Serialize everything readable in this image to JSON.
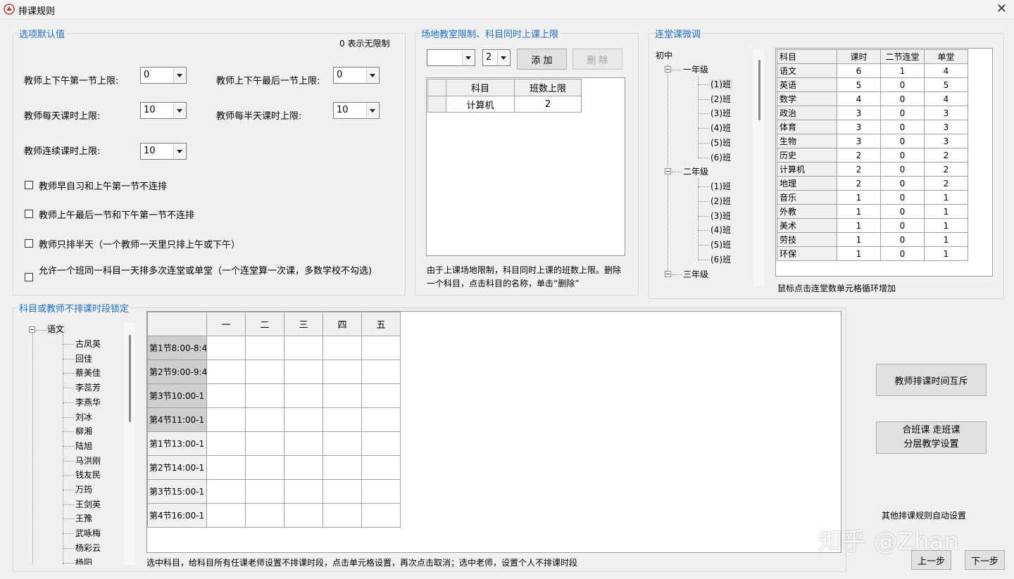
{
  "window": {
    "title": "排课规则",
    "close": "✕"
  },
  "options": {
    "legend": "选项默认值",
    "hint": "0 表示无限制",
    "fields": [
      {
        "label": "教师上下午第一节上限:",
        "value": "0"
      },
      {
        "label": "教师上下午最后一节上限:",
        "value": "0"
      },
      {
        "label": "教师每天课时上限:",
        "value": "10"
      },
      {
        "label": "教师每半天课时上限:",
        "value": "10"
      },
      {
        "label": "教师连续课时上限:",
        "value": "10"
      }
    ],
    "checkboxes": [
      {
        "label": "教师早自习和上午第一节不连排",
        "checked": false
      },
      {
        "label": "教师上午最后一节和下午第一节不连排",
        "checked": false
      },
      {
        "label": "教师只排半天（一个教师一天里只排上午或下午）",
        "checked": false
      },
      {
        "label": "允许一个班同一科目一天排多次连堂或单堂（一个连堂算一次课，多数学校不勾选)",
        "checked": false
      }
    ]
  },
  "venue": {
    "legend": "场地教室限制、科目同时上课上限",
    "subject_combo": "",
    "count_combo": "2",
    "add": "添 加",
    "delete": "删 除",
    "headers": [
      "科目",
      "班数上限"
    ],
    "rows": [
      [
        "计算机",
        "2"
      ]
    ],
    "note": "由于上课场地限制，科目同时上课的班数上限。删除一个科目，点击科目的名称，单击“删除”"
  },
  "consec": {
    "legend": "连堂课微调",
    "tree": {
      "root": "初中",
      "grades": [
        {
          "name": "一年级",
          "classes": [
            "(1)班",
            "(2)班",
            "(3)班",
            "(4)班",
            "(5)班",
            "(6)班"
          ]
        },
        {
          "name": "二年级",
          "classes": [
            "(1)班",
            "(2)班",
            "(3)班",
            "(4)班",
            "(5)班",
            "(6)班"
          ]
        },
        {
          "name": "三年级",
          "classes": []
        }
      ],
      "selected": "(1)班"
    },
    "headers": [
      "科目",
      "课时",
      "二节连堂",
      "单堂"
    ],
    "rows": [
      [
        "语文",
        "6",
        "1",
        "4"
      ],
      [
        "英语",
        "5",
        "0",
        "5"
      ],
      [
        "数学",
        "4",
        "0",
        "4"
      ],
      [
        "政治",
        "3",
        "0",
        "3"
      ],
      [
        "体育",
        "3",
        "0",
        "3"
      ],
      [
        "生物",
        "3",
        "0",
        "3"
      ],
      [
        "历史",
        "2",
        "0",
        "2"
      ],
      [
        "计算机",
        "2",
        "0",
        "2"
      ],
      [
        "地理",
        "2",
        "0",
        "2"
      ],
      [
        "音乐",
        "1",
        "0",
        "1"
      ],
      [
        "外教",
        "1",
        "0",
        "1"
      ],
      [
        "美术",
        "1",
        "0",
        "1"
      ],
      [
        "劳技",
        "1",
        "0",
        "1"
      ],
      [
        "环保",
        "1",
        "0",
        "1"
      ]
    ],
    "note": "鼠标点击连堂数单元格循环增加"
  },
  "lock": {
    "legend": "科目或教师不排课时段锁定",
    "subject": "语文",
    "teachers": [
      "古凤英",
      "回佳",
      "蔡美佳",
      "李蕊芳",
      "李燕华",
      "刘冰",
      "柳湘",
      "陆旭",
      "马洪刚",
      "钱友民",
      "万筠",
      "王剑英",
      "王豫",
      "武咏梅",
      "杨彩云",
      "杨阳"
    ],
    "days": [
      "一",
      "二",
      "三",
      "四",
      "五"
    ],
    "periods": [
      {
        "label": "第1节8:00-8:4",
        "am": true
      },
      {
        "label": "第2节9:00-9:4",
        "am": true
      },
      {
        "label": "第3节10:00-1",
        "am": true
      },
      {
        "label": "第4节11:00-1",
        "am": true
      },
      {
        "label": "第1节13:00-1",
        "am": false
      },
      {
        "label": "第2节14:00-1",
        "am": false
      },
      {
        "label": "第3节15:00-1",
        "am": false
      },
      {
        "label": "第4节16:00-1",
        "am": false
      }
    ],
    "note": "选中科目，给科目所有任课老师设置不排课时段，点击单元格设置，再次点击取消；选中老师，设置个人不排课时段"
  },
  "actions": {
    "mutual": "教师排课时间互斥",
    "merge_line1": "合班课 走班课",
    "merge_line2": "分层教学设置",
    "auto_note": "其他排课规则自动设置",
    "prev": "上一步",
    "next": "下一步"
  },
  "watermark": "知乎 @Zhan"
}
